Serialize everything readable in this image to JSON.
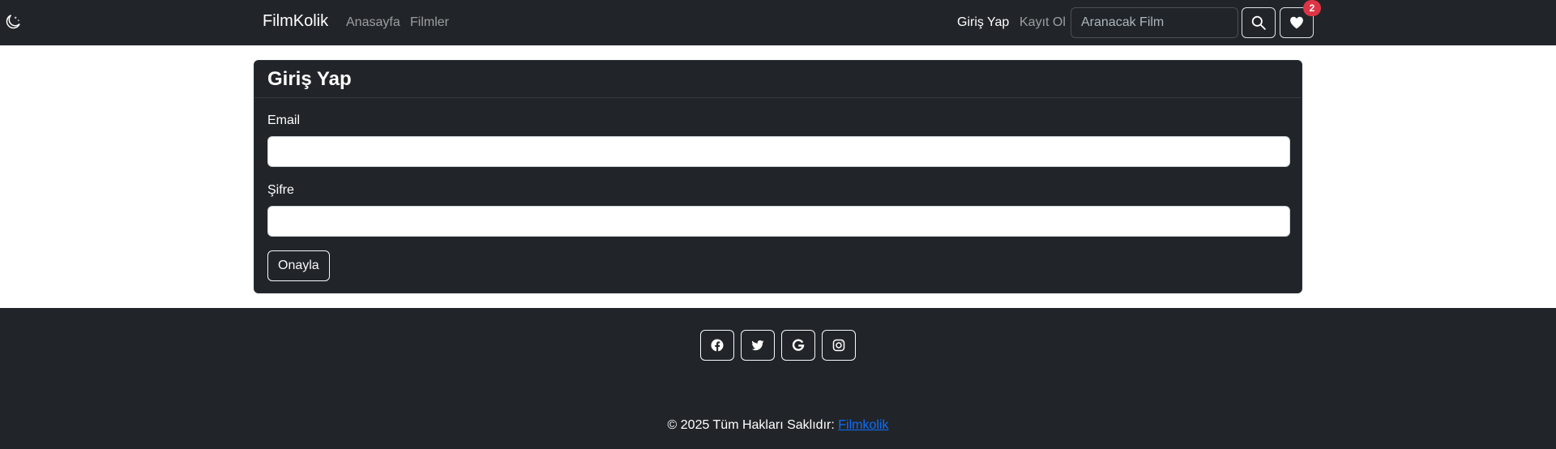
{
  "navbar": {
    "brand": "FilmKolik",
    "links": [
      "Anasayfa",
      "Filmler"
    ],
    "login_label": "Giriş Yap",
    "register_label": "Kayıt Ol",
    "search_placeholder": "Aranacak Film",
    "favorites_count": "2",
    "theme_icon": "moon-stars-icon",
    "search_icon": "search-icon",
    "favorites_icon": "heart-icon"
  },
  "login_form": {
    "title": "Giriş Yap",
    "email_label": "Email",
    "email_value": "",
    "password_label": "Şifre",
    "password_value": "",
    "submit_label": "Onayla"
  },
  "footer": {
    "social_icons": [
      "facebook-icon",
      "twitter-icon",
      "google-icon",
      "instagram-icon"
    ],
    "copyright_text": "© 2025 Tüm Hakları Saklıdır: ",
    "copyright_link": "Filmkolik"
  },
  "colors": {
    "dark_bg": "#212529",
    "badge": "#dc3545",
    "link": "#0d6efd"
  }
}
